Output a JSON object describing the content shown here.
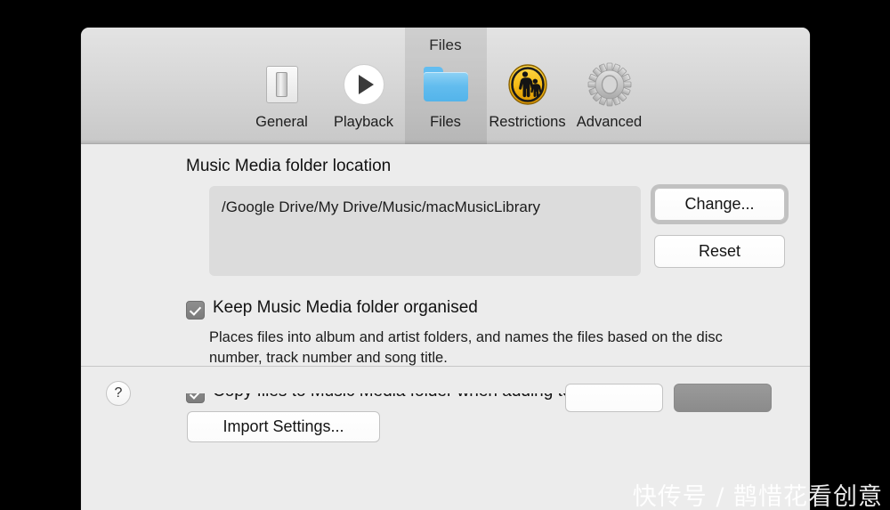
{
  "window": {
    "title": "Files",
    "background_color": "#000000",
    "toolbar_color": "#d9d9d9",
    "content_color": "#ececec"
  },
  "toolbar": {
    "tabs": [
      {
        "id": "general",
        "label": "General",
        "icon": "toggle-switch-icon",
        "selected": false
      },
      {
        "id": "playback",
        "label": "Playback",
        "icon": "play-circle-icon",
        "selected": false
      },
      {
        "id": "files",
        "label": "Files",
        "icon": "folder-icon",
        "selected": true
      },
      {
        "id": "restrictions",
        "label": "Restrictions",
        "icon": "parental-controls-icon",
        "selected": false
      },
      {
        "id": "advanced",
        "label": "Advanced",
        "icon": "gear-icon",
        "selected": false
      }
    ]
  },
  "main": {
    "section_title": "Music Media folder location",
    "path_value": "/Google Drive/My Drive/Music/macMusicLibrary",
    "change_label": "Change...",
    "reset_label": "Reset",
    "checkbox_organised": {
      "label": "Keep Music Media folder organised",
      "checked": true
    },
    "helper_text": "Places files into album and artist folders, and names the files based on the disc number, track number and song title.",
    "checkbox_copy": {
      "label": "Copy files to Music Media folder when adding to library",
      "checked": true
    },
    "import_settings_label": "Import Settings..."
  },
  "footer": {
    "help_glyph": "?"
  },
  "overlay": {
    "watermark": "快传号 / 鹊惜花看创意"
  }
}
